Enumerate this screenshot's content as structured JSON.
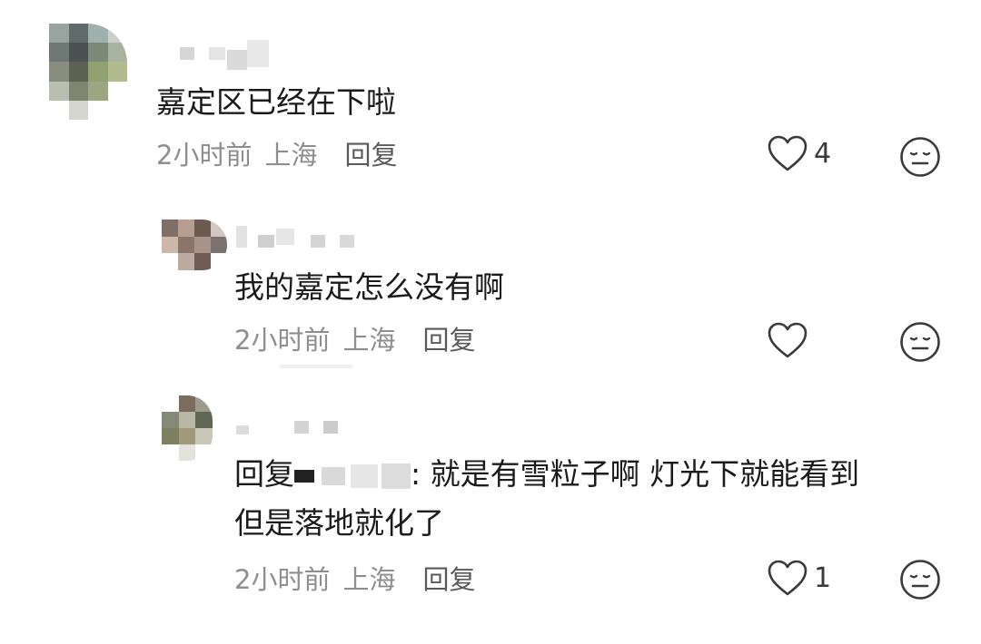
{
  "comments": [
    {
      "text": "嘉定区已经在下啦",
      "time": "2小时前",
      "location": "上海",
      "reply_label": "回复",
      "like_count": "4"
    },
    {
      "text": "我的嘉定怎么没有啊",
      "time": "2小时前",
      "location": "上海",
      "reply_label": "回复",
      "like_count": ""
    },
    {
      "reply_prefix": "回复",
      "text_line1": ": 就是有雪粒子啊 灯光下就能看到",
      "text_line2": "但是落地就化了",
      "time": "2小时前",
      "location": "上海",
      "reply_label": "回复",
      "like_count": "1"
    }
  ],
  "icons": {
    "like": "heart-outline-icon",
    "dislike": "neutral-face-icon"
  },
  "colors": {
    "text": "#1b1b1b",
    "meta": "#8e8e8e",
    "icon": "#3a3a3a"
  }
}
